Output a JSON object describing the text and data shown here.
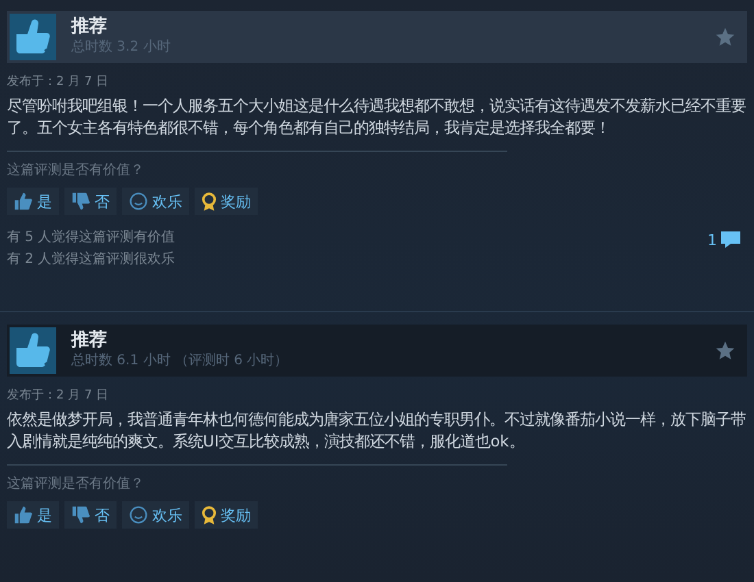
{
  "reviews": [
    {
      "highlighted": true,
      "verdict": "推荐",
      "hours": "总时数 3.2 小时",
      "posted": "发布于：2 月 7 日",
      "text": "尽管吩咐我吧组银！一个人服务五个大小姐这是什么待遇我想都不敢想，说实话有这待遇发不发薪水已经不重要了。五个女主各有特色都很不错，每个角色都有自己的独特结局，我肯定是选择我全都要！",
      "prompt": "这篇评测是否有价值？",
      "buttons": [
        {
          "kind": "yes",
          "label": "是"
        },
        {
          "kind": "no",
          "label": "否"
        },
        {
          "kind": "funny",
          "label": "欢乐"
        },
        {
          "kind": "award",
          "label": "奖励"
        }
      ],
      "stats": [
        "有 5 人觉得这篇评测有价值",
        "有 2 人觉得这篇评测很欢乐"
      ],
      "comments": "1"
    },
    {
      "highlighted": false,
      "verdict": "推荐",
      "hours": "总时数 6.1 小时 （评测时 6 小时）",
      "posted": "发布于：2 月 7 日",
      "text": "依然是做梦开局，我普通青年林也何德何能成为唐家五位小姐的专职男仆。不过就像番茄小说一样，放下脑子带入剧情就是纯纯的爽文。系统UI交互比较成熟，演技都还不错，服化道也ok。",
      "prompt": "这篇评测是否有价值？",
      "buttons": [
        {
          "kind": "yes",
          "label": "是"
        },
        {
          "kind": "no",
          "label": "否"
        },
        {
          "kind": "funny",
          "label": "欢乐"
        },
        {
          "kind": "award",
          "label": "奖励"
        }
      ]
    }
  ]
}
